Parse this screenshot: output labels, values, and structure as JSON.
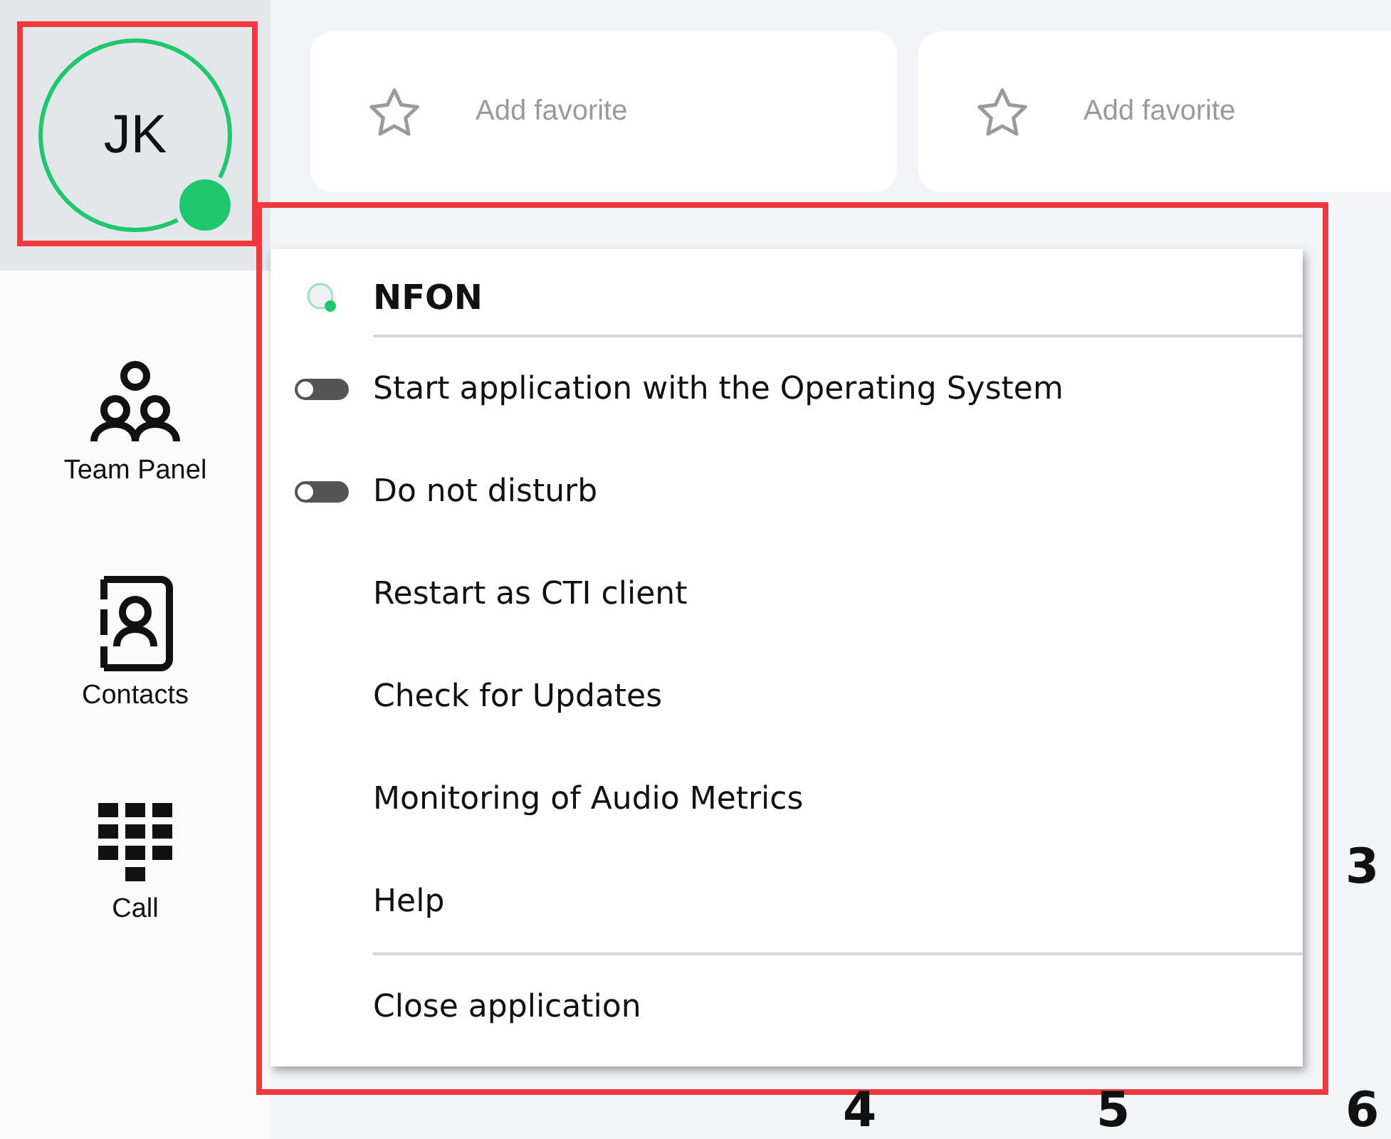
{
  "user": {
    "initials": "JK",
    "online": true,
    "highlighted": true
  },
  "nav": [
    {
      "label": "Team Panel"
    },
    {
      "label": "Contacts"
    },
    {
      "label": "Call"
    }
  ],
  "favorites": [
    {
      "label": "Add favorite"
    },
    {
      "label": "Add favorite"
    }
  ],
  "menu": {
    "highlighted": true,
    "title": "NFON",
    "items": [
      {
        "kind": "toggle",
        "label": "Start application with the Operating System",
        "on": false
      },
      {
        "kind": "toggle",
        "label": "Do not disturb",
        "on": false
      },
      {
        "kind": "action",
        "label": "Restart as CTI client"
      },
      {
        "kind": "action",
        "label": "Check for Updates"
      },
      {
        "kind": "action",
        "label": "Monitoring of Audio Metrics"
      },
      {
        "kind": "action",
        "label": "Help"
      },
      {
        "kind": "divider"
      },
      {
        "kind": "action",
        "label": "Close application"
      }
    ]
  },
  "callouts": [
    "3",
    "4",
    "5",
    "6"
  ]
}
